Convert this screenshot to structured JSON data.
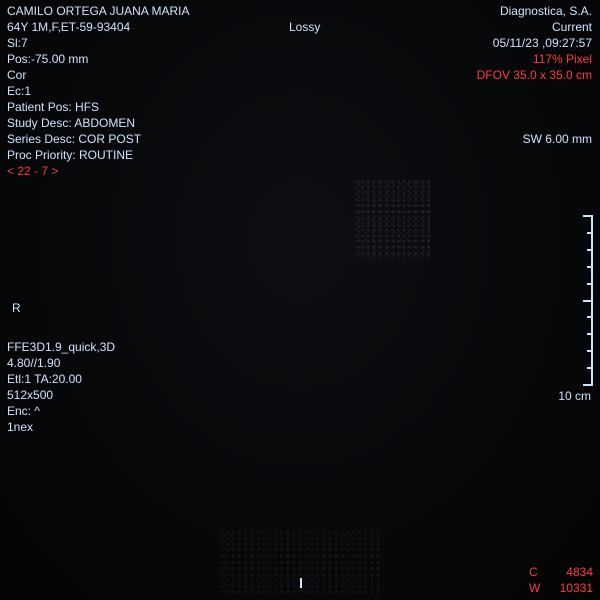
{
  "top_left": {
    "patient_name": "CAMILO ORTEGA JUANA MARIA",
    "patient_info": "64Y 1M,F,ET-59-93404",
    "slice": "Sl:7",
    "position": "Pos:-75.00 mm",
    "orientation": "Cor",
    "echo": "Ec:1",
    "patient_pos": "Patient Pos: HFS",
    "study_desc": "Study Desc: ABDOMEN",
    "series_desc": "Series Desc: COR POST",
    "proc_priority": "Proc Priority: ROUTINE",
    "series_nav": "< 22 - 7 >"
  },
  "top_center": {
    "compression": "Lossy"
  },
  "top_right": {
    "institution": "Diagnostica,  S.A.",
    "status": "Current",
    "datetime": "05/11/23 ,09:27:57",
    "zoom": "117% Pixel",
    "dfov": "DFOV 35.0 x 35.0 cm",
    "slice_width": "SW 6.00 mm"
  },
  "left_orientation": {
    "label": "R"
  },
  "bottom_left": {
    "sequence": "FFE3D1.9_quick,3D",
    "tr_te": "4.80//1.90",
    "etl_ta": "Etl:1 TA:20.00",
    "matrix": "512x500",
    "enc": "Enc: ^",
    "nex": "1nex"
  },
  "scale": {
    "label": "10 cm",
    "tick_count": 11
  },
  "window_level": {
    "center_label": "C",
    "center_value": "4834",
    "width_label": "W",
    "width_value": "10331"
  },
  "colors": {
    "overlay_text": "#cfe3ff",
    "highlight_text": "#ff3b3b",
    "background": "#050507"
  }
}
